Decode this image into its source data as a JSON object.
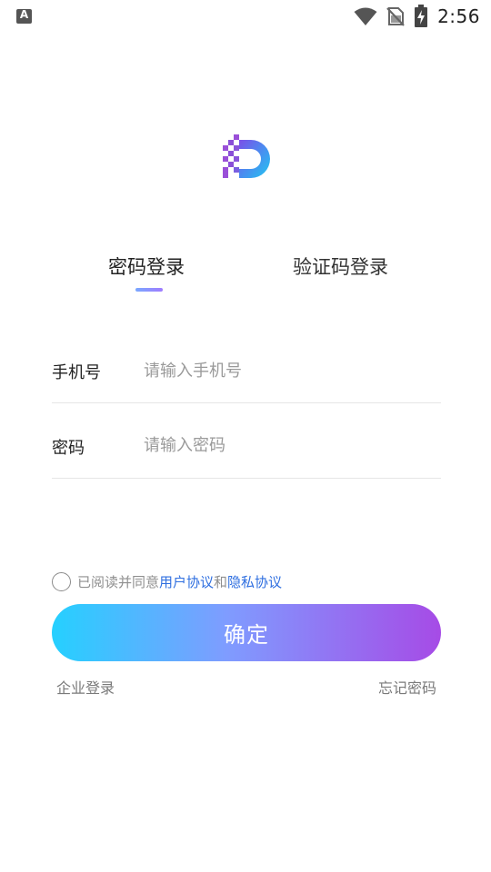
{
  "status_bar": {
    "app_indicator": "A",
    "time": "2:56"
  },
  "tabs": [
    {
      "label": "密码登录",
      "active": true
    },
    {
      "label": "验证码登录",
      "active": false
    }
  ],
  "form": {
    "phone": {
      "label": "手机号",
      "placeholder": "请输入手机号",
      "value": ""
    },
    "password": {
      "label": "密码",
      "placeholder": "请输入密码",
      "value": ""
    }
  },
  "agreement": {
    "checked": false,
    "prefix": "已阅读并同意",
    "user_agreement": "用户协议",
    "conjunction": "和",
    "privacy_agreement": "隐私协议"
  },
  "confirm_label": "确定",
  "links": {
    "enterprise_login": "企业登录",
    "forgot_password": "忘记密码"
  },
  "colors": {
    "link": "#2f6fe0",
    "button_gradient_start": "#25d0ff",
    "button_gradient_end": "#a64be6"
  }
}
